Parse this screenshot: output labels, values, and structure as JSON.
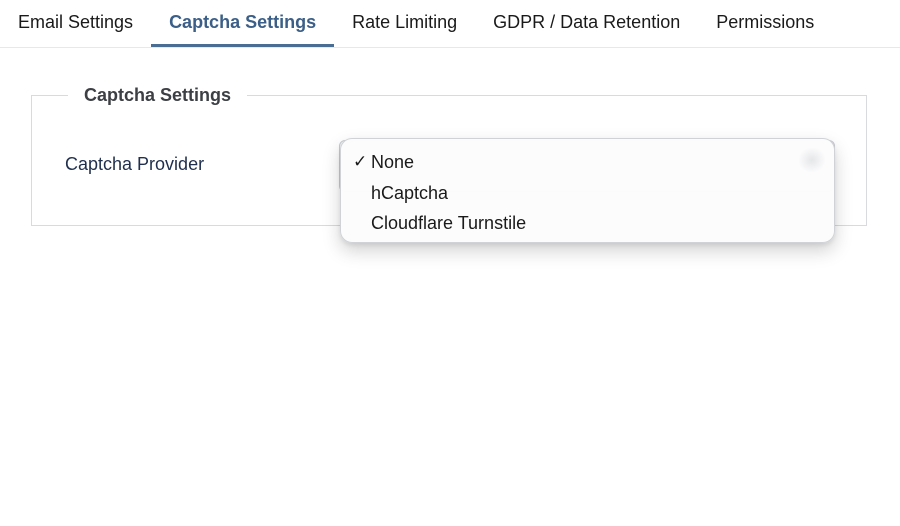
{
  "tabs": [
    {
      "label": "Email Settings",
      "active": false
    },
    {
      "label": "Captcha Settings",
      "active": true
    },
    {
      "label": "Rate Limiting",
      "active": false
    },
    {
      "label": "GDPR / Data Retention",
      "active": false
    },
    {
      "label": "Permissions",
      "active": false
    }
  ],
  "section": {
    "legend": "Captcha Settings",
    "field_label": "Captcha Provider"
  },
  "select": {
    "selected_value": "None",
    "options": [
      {
        "label": "None",
        "checked": true
      },
      {
        "label": "hCaptcha",
        "checked": false
      },
      {
        "label": "Cloudflare Turnstile",
        "checked": false
      }
    ],
    "check_glyph": "✓"
  },
  "colors": {
    "active_tab": "#3b5f88",
    "label_text": "#1f2f4d"
  }
}
